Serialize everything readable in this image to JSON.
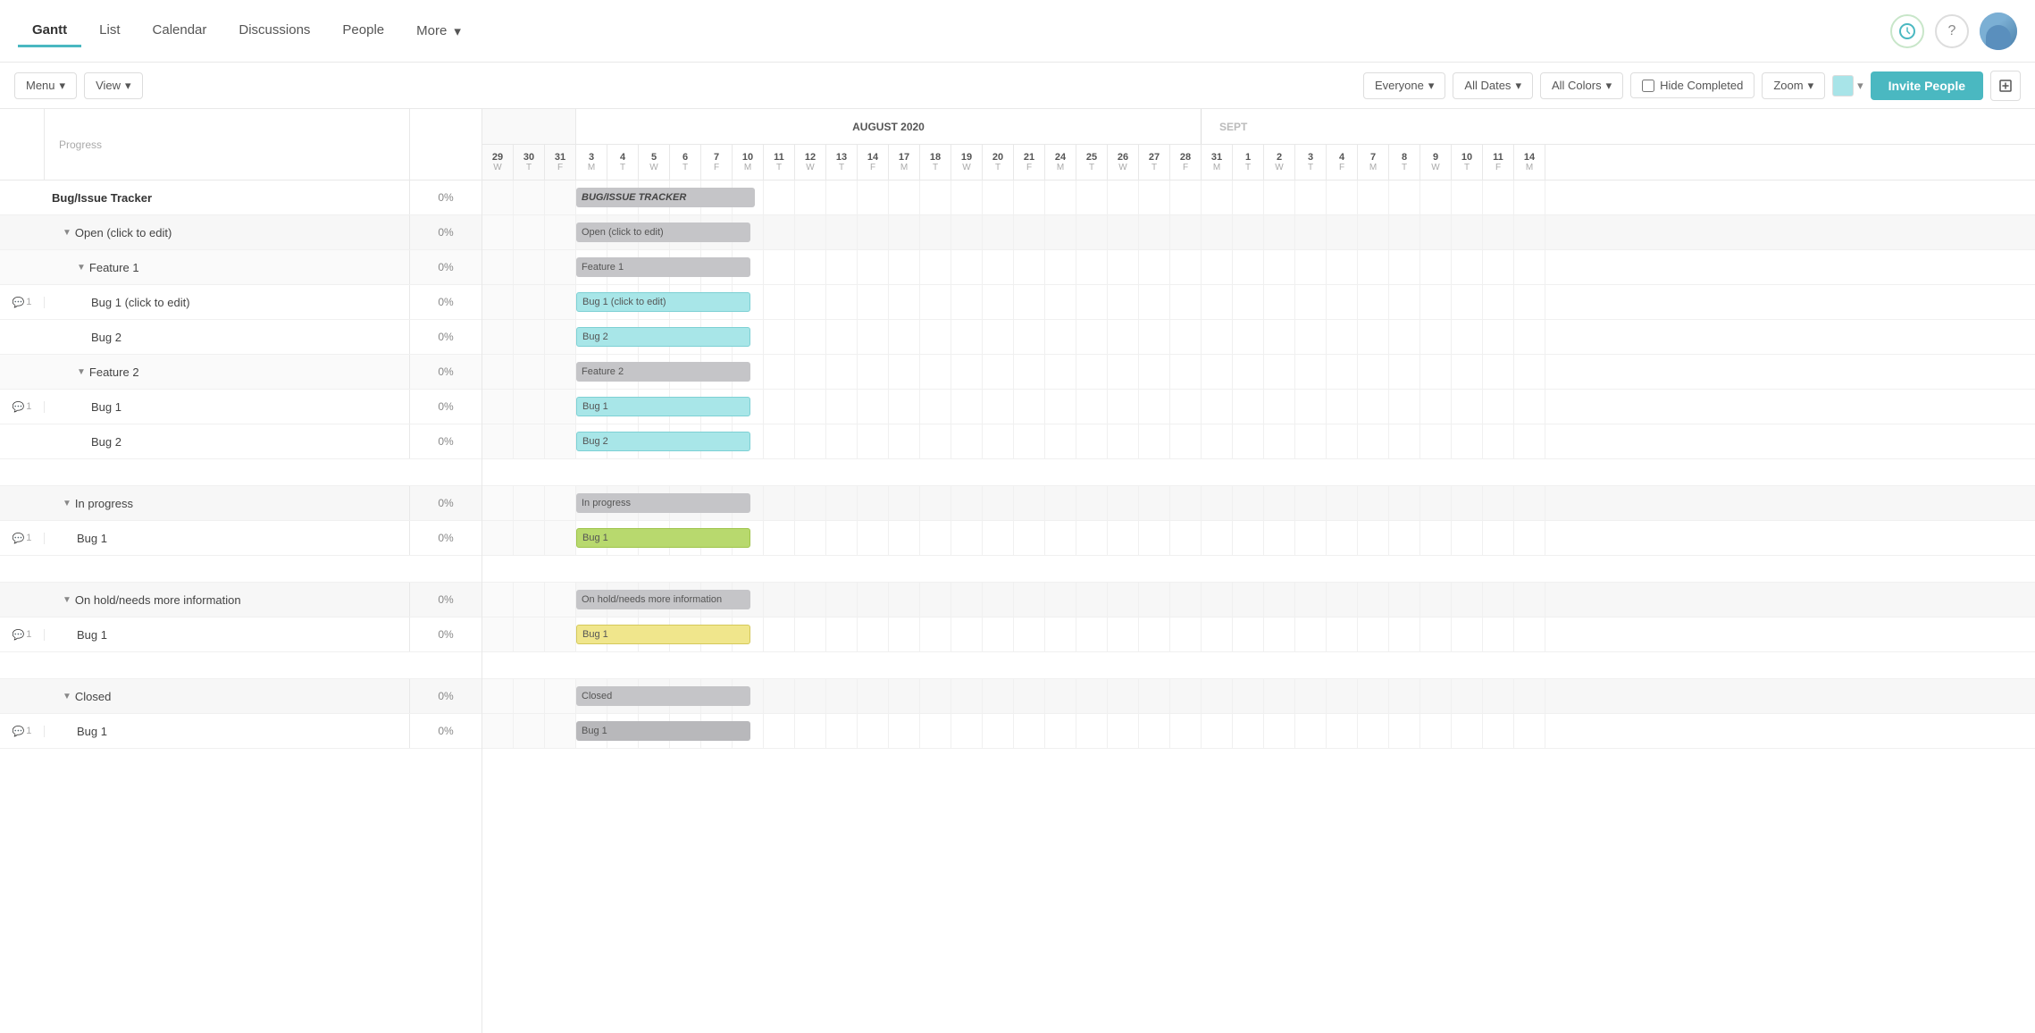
{
  "nav": {
    "items": [
      {
        "label": "Gantt",
        "active": true
      },
      {
        "label": "List",
        "active": false
      },
      {
        "label": "Calendar",
        "active": false
      },
      {
        "label": "Discussions",
        "active": false
      },
      {
        "label": "People",
        "active": false
      },
      {
        "label": "More",
        "active": false,
        "has_arrow": true
      }
    ]
  },
  "toolbar": {
    "menu_label": "Menu",
    "view_label": "View",
    "everyone_label": "Everyone",
    "all_dates_label": "All Dates",
    "all_colors_label": "All Colors",
    "hide_completed_label": "Hide Completed",
    "zoom_label": "Zoom",
    "invite_label": "Invite People"
  },
  "gantt": {
    "month": "AUGUST 2020",
    "month_sep": "SEPT",
    "days": [
      {
        "num": "29",
        "day": "W"
      },
      {
        "num": "30",
        "day": "T"
      },
      {
        "num": "31",
        "day": "F"
      },
      {
        "num": "3",
        "day": "M"
      },
      {
        "num": "4",
        "day": "T"
      },
      {
        "num": "5",
        "day": "W"
      },
      {
        "num": "6",
        "day": "T"
      },
      {
        "num": "7",
        "day": "F"
      },
      {
        "num": "10",
        "day": "M"
      },
      {
        "num": "11",
        "day": "T"
      },
      {
        "num": "12",
        "day": "W"
      },
      {
        "num": "13",
        "day": "T"
      },
      {
        "num": "14",
        "day": "F"
      },
      {
        "num": "17",
        "day": "M"
      },
      {
        "num": "18",
        "day": "T"
      },
      {
        "num": "19",
        "day": "W"
      },
      {
        "num": "20",
        "day": "T"
      },
      {
        "num": "21",
        "day": "F"
      },
      {
        "num": "24",
        "day": "M"
      },
      {
        "num": "25",
        "day": "T"
      },
      {
        "num": "26",
        "day": "W"
      },
      {
        "num": "27",
        "day": "T"
      },
      {
        "num": "28",
        "day": "F"
      },
      {
        "num": "31",
        "day": "M"
      },
      {
        "num": "1",
        "day": "T"
      },
      {
        "num": "2",
        "day": "W"
      },
      {
        "num": "3",
        "day": "T"
      },
      {
        "num": "4",
        "day": "F"
      },
      {
        "num": "7",
        "day": "M"
      },
      {
        "num": "8",
        "day": "T"
      },
      {
        "num": "9",
        "day": "W"
      },
      {
        "num": "10",
        "day": "T"
      },
      {
        "num": "11",
        "day": "F"
      },
      {
        "num": "14",
        "day": "M"
      }
    ],
    "rows": [
      {
        "id": "tracker",
        "label": "Bug/Issue Tracker",
        "progress": "0%",
        "indent": 0,
        "type": "header",
        "has_comment": false
      },
      {
        "id": "open",
        "label": "Open (click to edit)",
        "progress": "0%",
        "indent": 1,
        "type": "group",
        "collapsed": true,
        "has_comment": false
      },
      {
        "id": "feature1",
        "label": "Feature 1",
        "progress": "0%",
        "indent": 2,
        "type": "subgroup",
        "collapsed": true,
        "has_comment": false
      },
      {
        "id": "bug1-f1",
        "label": "Bug 1 (click to edit)",
        "progress": "0%",
        "indent": 3,
        "type": "task",
        "has_comment": true
      },
      {
        "id": "bug2-f1",
        "label": "Bug 2",
        "progress": "0%",
        "indent": 3,
        "type": "task",
        "has_comment": false
      },
      {
        "id": "feature2",
        "label": "Feature 2",
        "progress": "0%",
        "indent": 2,
        "type": "subgroup",
        "collapsed": true,
        "has_comment": false
      },
      {
        "id": "bug1-f2",
        "label": "Bug 1",
        "progress": "0%",
        "indent": 3,
        "type": "task",
        "has_comment": true
      },
      {
        "id": "bug2-f2",
        "label": "Bug 2",
        "progress": "0%",
        "indent": 3,
        "type": "task",
        "has_comment": false
      },
      {
        "id": "spacer1",
        "label": "",
        "progress": "",
        "indent": 0,
        "type": "spacer",
        "has_comment": false
      },
      {
        "id": "inprogress",
        "label": "In progress",
        "progress": "0%",
        "indent": 1,
        "type": "group",
        "collapsed": true,
        "has_comment": false
      },
      {
        "id": "bug1-ip",
        "label": "Bug 1",
        "progress": "0%",
        "indent": 2,
        "type": "task",
        "has_comment": true
      },
      {
        "id": "spacer2",
        "label": "",
        "progress": "",
        "indent": 0,
        "type": "spacer",
        "has_comment": false
      },
      {
        "id": "onhold",
        "label": "On hold/needs more information",
        "progress": "0%",
        "indent": 1,
        "type": "group",
        "collapsed": true,
        "has_comment": false
      },
      {
        "id": "bug1-oh",
        "label": "Bug 1",
        "progress": "0%",
        "indent": 2,
        "type": "task",
        "has_comment": true
      },
      {
        "id": "spacer3",
        "label": "",
        "progress": "",
        "indent": 0,
        "type": "spacer",
        "has_comment": false
      },
      {
        "id": "closed",
        "label": "Closed",
        "progress": "0%",
        "indent": 1,
        "type": "group",
        "collapsed": true,
        "has_comment": false
      },
      {
        "id": "bug1-cl",
        "label": "Bug 1",
        "progress": "0%",
        "indent": 2,
        "type": "task",
        "has_comment": true
      }
    ]
  }
}
